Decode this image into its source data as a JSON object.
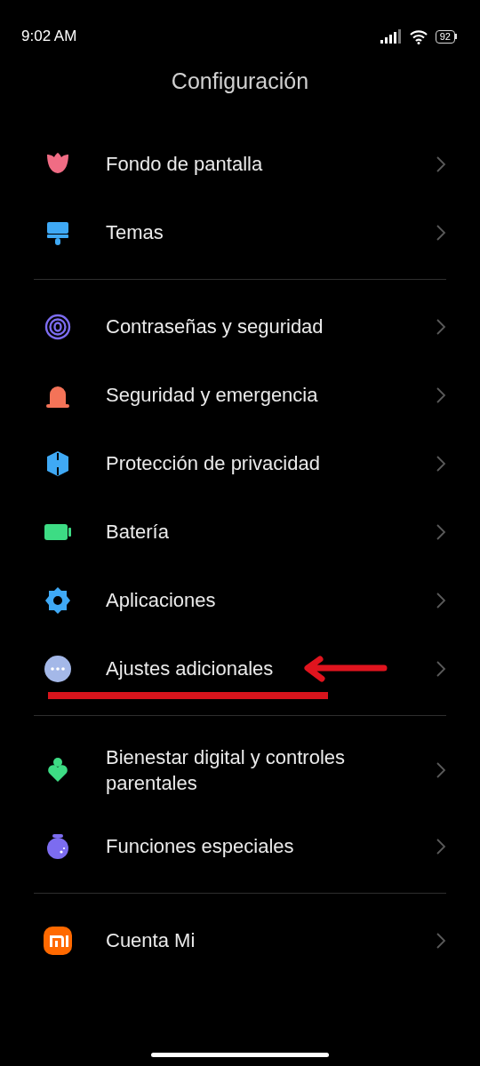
{
  "status_bar": {
    "time": "9:02 AM",
    "battery": "92"
  },
  "title": "Configuración",
  "groups": [
    {
      "items": [
        {
          "label": "Fondo de pantalla",
          "highlighted": false
        },
        {
          "label": "Temas",
          "highlighted": false
        }
      ]
    },
    {
      "items": [
        {
          "label": "Contraseñas y seguridad",
          "highlighted": false
        },
        {
          "label": "Seguridad y emergencia",
          "highlighted": false
        },
        {
          "label": "Protección de privacidad",
          "highlighted": false
        },
        {
          "label": "Batería",
          "highlighted": false
        },
        {
          "label": "Aplicaciones",
          "highlighted": false
        },
        {
          "label": "Ajustes adicionales",
          "highlighted": true
        }
      ]
    },
    {
      "items": [
        {
          "label": "Bienestar digital y controles parentales",
          "highlighted": false
        },
        {
          "label": "Funciones especiales",
          "highlighted": false
        }
      ]
    },
    {
      "items": [
        {
          "label": "Cuenta Mi",
          "highlighted": false
        }
      ]
    }
  ]
}
